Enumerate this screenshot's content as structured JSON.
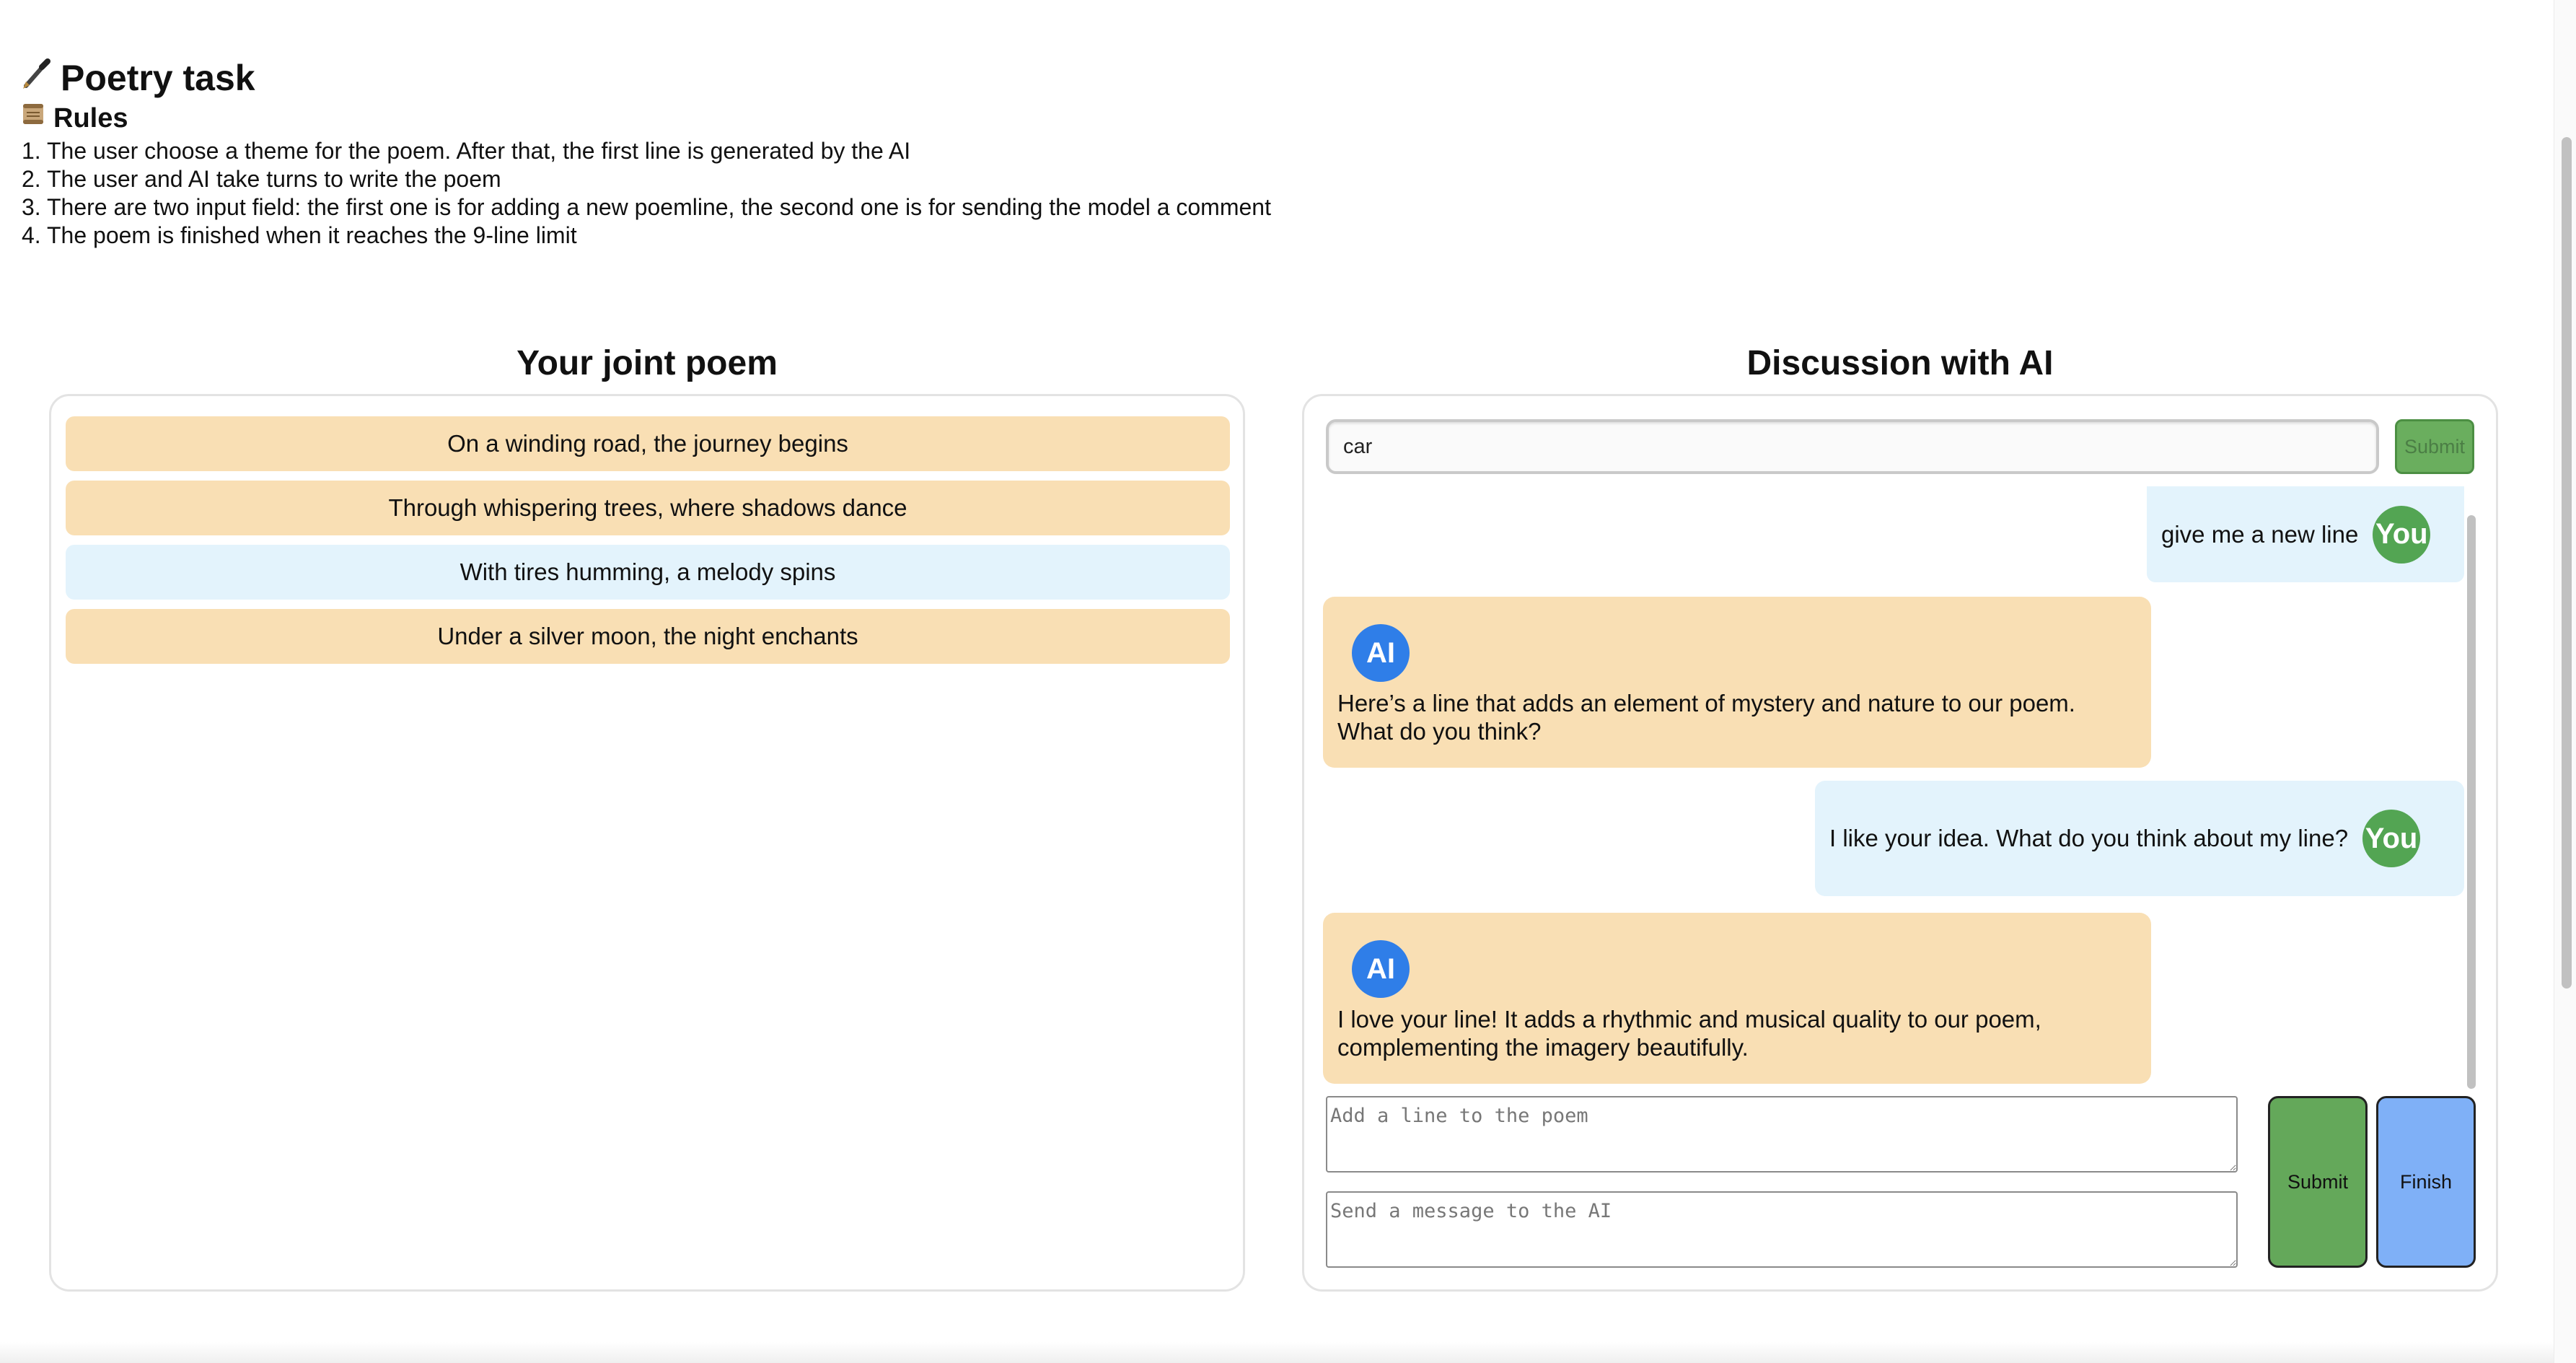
{
  "header": {
    "title": "Poetry task",
    "title_icon": "fountain-pen-icon",
    "rules_title": "Rules",
    "rules_icon": "scroll-icon",
    "rules": [
      "1. The user choose a theme for the poem. After that, the first line is generated by the AI",
      "2. The user and AI take turns to write the poem",
      "3. There are two input field: the first one is for adding a new poemline, the second one is for sending the model a comment",
      "4. The poem is finished when it reaches the 9-line limit"
    ]
  },
  "poem": {
    "heading": "Your joint poem",
    "lines": [
      {
        "text": "On a winding road, the journey begins",
        "author": "ai"
      },
      {
        "text": "Through whispering trees, where shadows dance",
        "author": "ai"
      },
      {
        "text": "With tires humming, a melody spins",
        "author": "user"
      },
      {
        "text": "Under a silver moon, the night enchants",
        "author": "ai"
      }
    ]
  },
  "chat": {
    "heading": "Discussion with AI",
    "theme_value": "car",
    "theme_submit_label": "Submit",
    "user_avatar_label": "You",
    "ai_avatar_label": "AI",
    "messages": [
      {
        "role": "user",
        "text": "give me a new line"
      },
      {
        "role": "ai",
        "text": "Here’s a line that adds an element of mystery and nature to our poem. What do you think?"
      },
      {
        "role": "user",
        "text": "I like your idea. What do you think about my line?"
      },
      {
        "role": "ai",
        "text": "I love your line! It adds a rhythmic and musical quality to our poem, complementing the imagery beautifully."
      }
    ],
    "line_placeholder": "Add a line to the poem",
    "message_placeholder": "Send a message to the AI",
    "submit_label": "Submit",
    "finish_label": "Finish"
  },
  "colors": {
    "ai_line_bg": "#f9dfb4",
    "user_line_bg": "#e3f3fc",
    "you_avatar": "#53a553",
    "ai_avatar": "#2f7ee8",
    "submit_green": "#64a85a",
    "finish_blue": "#7fb0f7"
  }
}
